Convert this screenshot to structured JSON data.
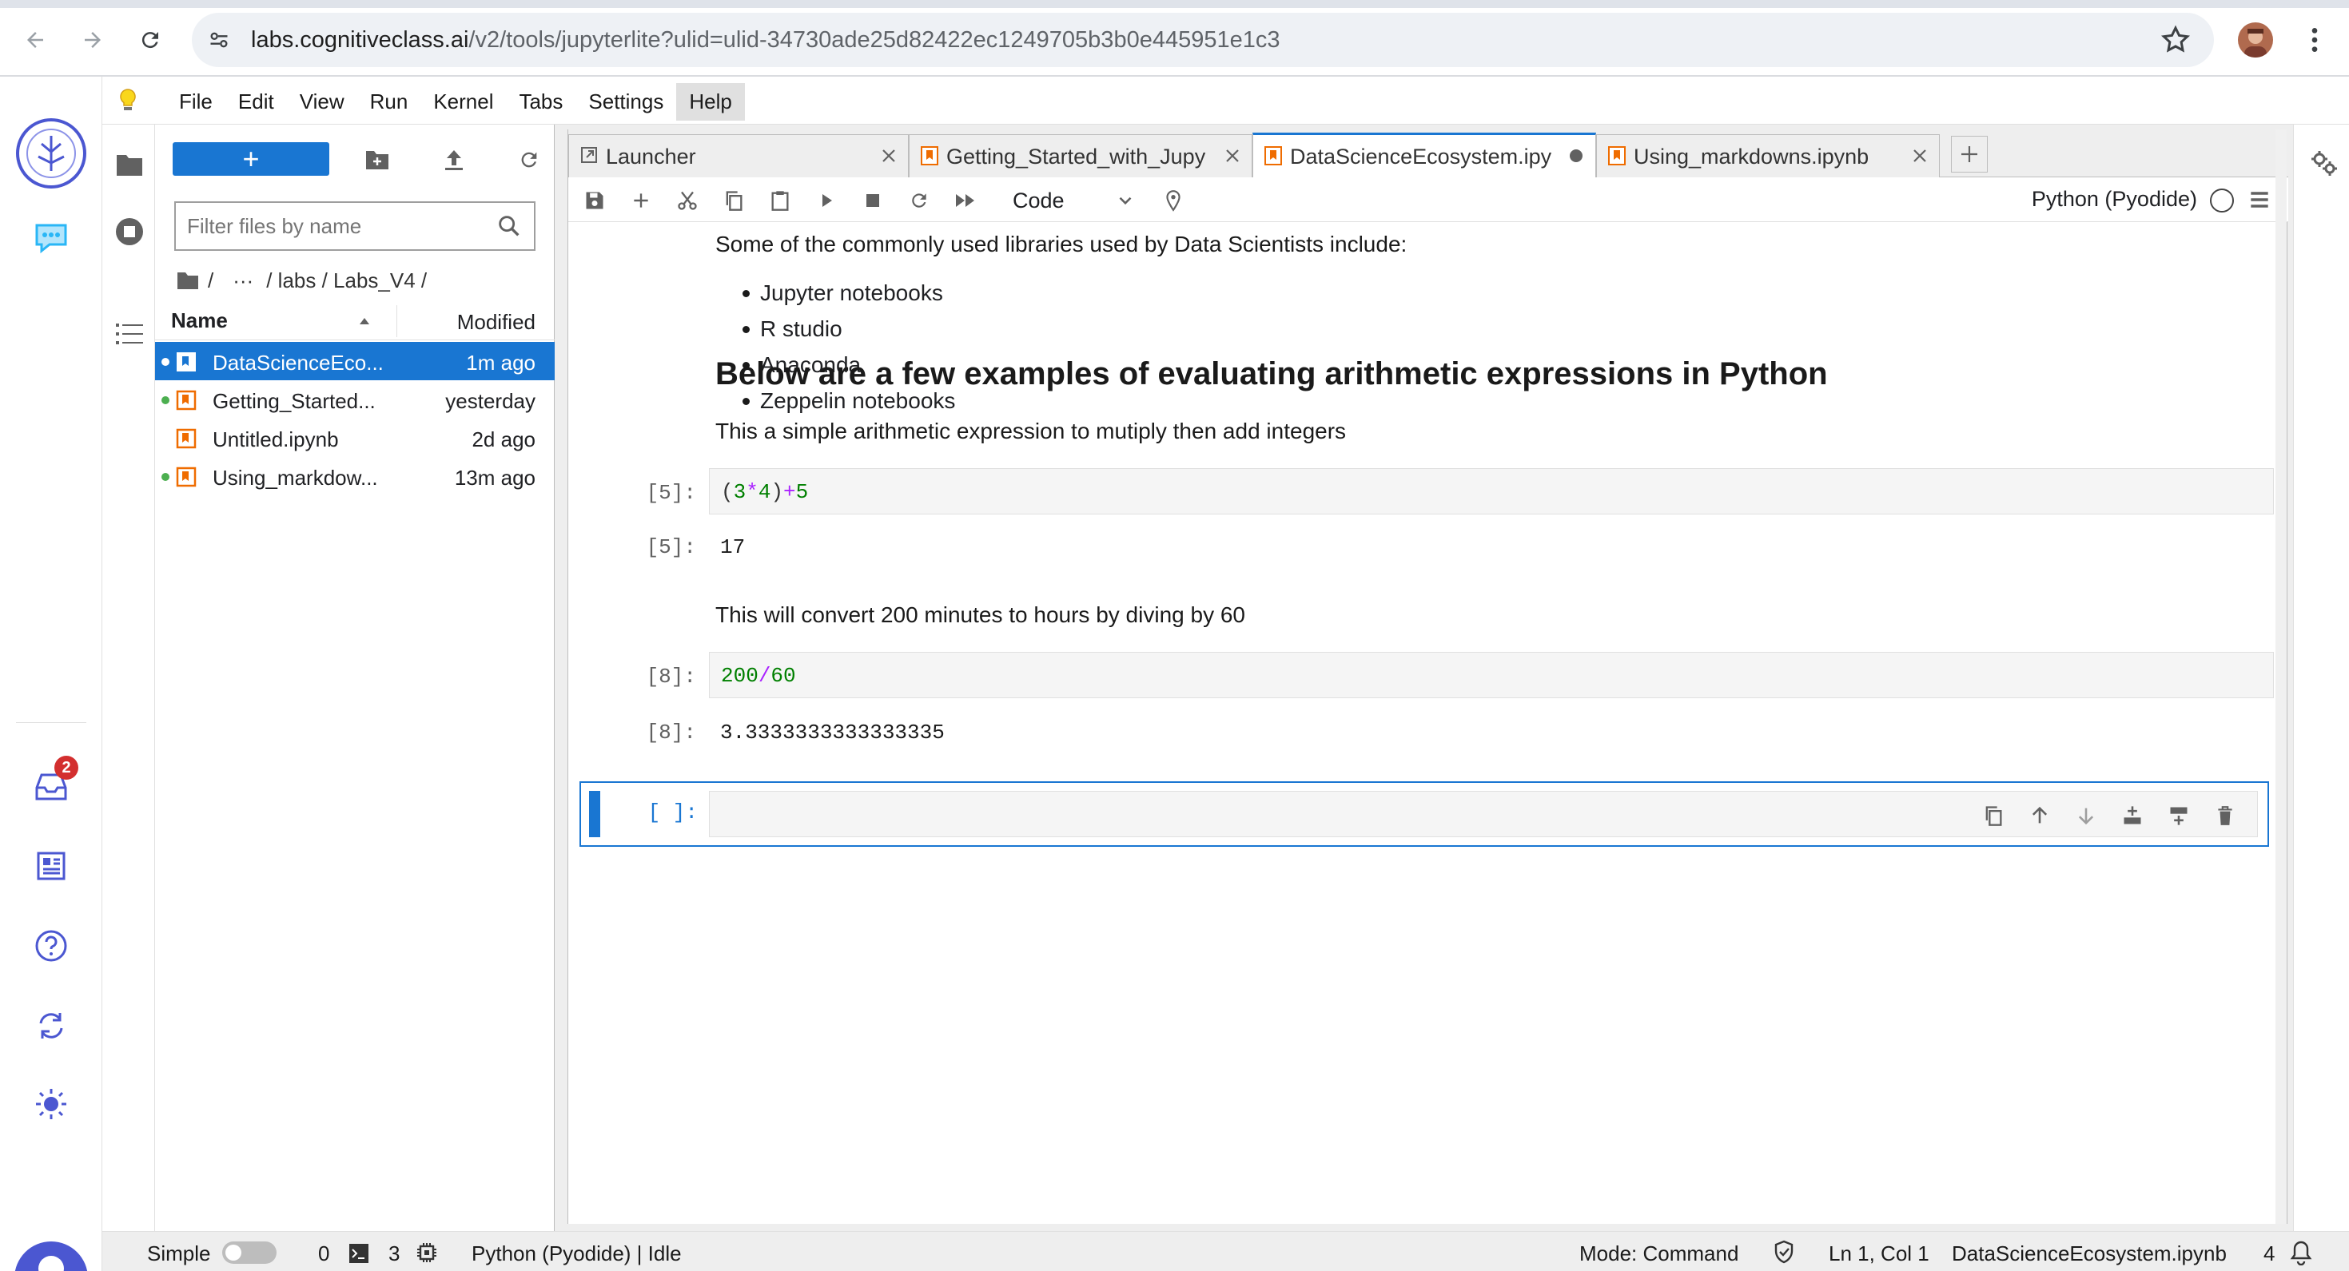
{
  "browser": {
    "url_host": "labs.cognitiveclass.ai",
    "url_path": "/v2/tools/jupyterlite?ulid=ulid-34730ade25d82422ec1249705b3b0e445951e1c3"
  },
  "menubar": {
    "items": [
      "File",
      "Edit",
      "View",
      "Run",
      "Kernel",
      "Tabs",
      "Settings",
      "Help"
    ]
  },
  "activity": {
    "notification_count": "2"
  },
  "filebrowser": {
    "new_label": "+",
    "filter_placeholder": "Filter files by name",
    "breadcrumb": {
      "root": "/",
      "ellipsis": "···",
      "path": "/ labs / Labs_V4 /"
    },
    "col_name": "Name",
    "col_modified": "Modified",
    "files": [
      {
        "name": "DataScienceEco...",
        "modified": "1m ago"
      },
      {
        "name": "Getting_Started...",
        "modified": "yesterday"
      },
      {
        "name": "Untitled.ipynb",
        "modified": "2d ago"
      },
      {
        "name": "Using_markdow...",
        "modified": "13m ago"
      }
    ]
  },
  "tabs": [
    {
      "label": "Launcher"
    },
    {
      "label": "Getting_Started_with_Jupy"
    },
    {
      "label": "DataScienceEcosystem.ipy"
    },
    {
      "label": "Using_markdowns.ipynb"
    }
  ],
  "toolbar": {
    "cell_type": "Code",
    "kernel": "Python (Pyodide)"
  },
  "notebook": {
    "libraries_intro": "Some of the commonly used libraries used by Data Scientists include:",
    "libraries": [
      "Jupyter notebooks",
      "R studio",
      "Anaconda",
      "Zeppelin notebooks"
    ],
    "heading": "Below are a few examples of evaluating arithmetic expressions in Python",
    "expr_intro": "This a simple arithmetic expression to mutiply then add integers",
    "cell1": {
      "in_prompt": "[5]:",
      "out_prompt": "[5]:",
      "code_open": "(",
      "n1": "3",
      "op1": "*",
      "n2": "4",
      "code_close": ")",
      "op2": "+",
      "n3": "5",
      "output": "17"
    },
    "convert_intro": "This will convert 200 minutes to hours by diving by 60",
    "cell2": {
      "in_prompt": "[8]:",
      "out_prompt": "[8]:",
      "n1": "200",
      "op": "/",
      "n2": "60",
      "output": "3.3333333333333335"
    },
    "cell3": {
      "in_prompt": "[ ]:"
    }
  },
  "statusbar": {
    "mode_label": "Simple",
    "terminals": "0",
    "kernels": "3",
    "kernel_state": "Python (Pyodide) | Idle",
    "mode": "Mode: Command",
    "cursor": "Ln 1, Col 1",
    "filename": "DataScienceEcosystem.ipynb",
    "notifications": "4"
  },
  "colors": {
    "accent": "#1976d2",
    "number": "#008000",
    "operator": "#aa22ff",
    "badge": "#d32f2f"
  }
}
